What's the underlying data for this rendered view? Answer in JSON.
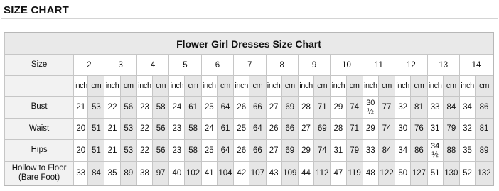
{
  "page": {
    "heading": "SIZE CHART"
  },
  "table": {
    "title": "Flower Girl Dresses Size Chart",
    "size_label": "Size",
    "sizes": [
      "2",
      "3",
      "4",
      "5",
      "6",
      "7",
      "8",
      "9",
      "10",
      "11",
      "12",
      "13",
      "14"
    ],
    "unit_inch": "inch",
    "unit_cm": "cm",
    "rows": [
      {
        "label": "Bust",
        "values": [
          "21",
          "53",
          "22",
          "56",
          "23",
          "58",
          "24",
          "61",
          "25",
          "64",
          "26",
          "66",
          "27",
          "69",
          "28",
          "71",
          "29",
          "74",
          "30 ½",
          "77",
          "32",
          "81",
          "33",
          "84",
          "34",
          "86"
        ]
      },
      {
        "label": "Waist",
        "values": [
          "20",
          "51",
          "21",
          "53",
          "22",
          "56",
          "23",
          "58",
          "24",
          "61",
          "25",
          "64",
          "26",
          "66",
          "27",
          "69",
          "28",
          "71",
          "29",
          "74",
          "30",
          "76",
          "31",
          "79",
          "32",
          "81"
        ]
      },
      {
        "label": "Hips",
        "values": [
          "20",
          "51",
          "21",
          "53",
          "22",
          "56",
          "23",
          "58",
          "25",
          "64",
          "26",
          "66",
          "27",
          "69",
          "29",
          "74",
          "31",
          "79",
          "33",
          "84",
          "34",
          "86",
          "34 ½",
          "88",
          "35",
          "89"
        ]
      },
      {
        "label": "Hollow to Floor (Bare Foot)",
        "values": [
          "33",
          "84",
          "35",
          "89",
          "38",
          "97",
          "40",
          "102",
          "41",
          "104",
          "42",
          "107",
          "43",
          "109",
          "44",
          "112",
          "47",
          "119",
          "48",
          "122",
          "50",
          "127",
          "51",
          "130",
          "52",
          "132"
        ]
      }
    ]
  }
}
